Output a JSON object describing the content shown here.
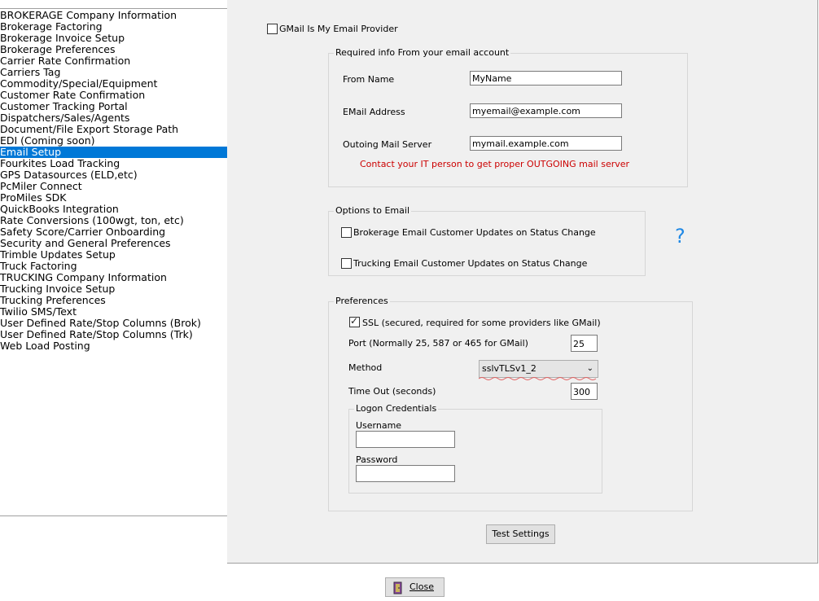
{
  "sidebar": {
    "items": [
      "BROKERAGE Company Information",
      "Brokerage Factoring",
      "Brokerage Invoice Setup",
      "Brokerage Preferences",
      "Carrier Rate Confirmation",
      "Carriers Tag",
      "Commodity/Special/Equipment",
      "Customer Rate Confirmation",
      "Customer Tracking Portal",
      "Dispatchers/Sales/Agents",
      "Document/File Export Storage Path",
      "EDI (Coming soon)",
      "Email Setup",
      "Fourkites Load Tracking",
      "GPS Datasources (ELD,etc)",
      "PcMiler Connect",
      "ProMiles SDK",
      "QuickBooks Integration",
      "Rate Conversions (100wgt, ton, etc)",
      "Safety Score/Carrier Onboarding",
      "Security and General Preferences",
      "Trimble Updates Setup",
      "Truck Factoring",
      "TRUCKING Company Information",
      "Trucking Invoice Setup",
      "Trucking Preferences",
      "Twilio SMS/Text",
      "User Defined Rate/Stop Columns (Brok)",
      "User Defined Rate/Stop Columns (Trk)",
      "Web Load Posting"
    ],
    "selected": "Email Setup"
  },
  "gmail": {
    "label": "GMail Is My Email Provider",
    "checked": false
  },
  "required": {
    "title": "Required info From your email account",
    "from_name_label": "From Name",
    "from_name_value": "MyName",
    "email_label": "EMail Address",
    "email_value": "myemail@example.com",
    "server_label": "Outoing Mail Server",
    "server_value": "mymail.example.com",
    "warning": "Contact your IT person to get proper OUTGOING mail server",
    "warning_color": "#cc0000"
  },
  "options": {
    "title": "Options to Email",
    "brokerage_label": "Brokerage Email Customer Updates on Status Change",
    "brokerage_checked": false,
    "trucking_label": "Trucking Email Customer Updates on Status Change",
    "trucking_checked": false,
    "help_glyph": "?"
  },
  "preferences": {
    "title": "Preferences",
    "ssl_label": "SSL (secured, required for some providers like GMail)",
    "ssl_checked": true,
    "port_label": "Port (Normally 25, 587 or 465 for GMail)",
    "port_value": "25",
    "method_label": "Method",
    "method_value": "sslvTLSv1_2",
    "timeout_label": "Time Out (seconds)",
    "timeout_value": "300",
    "logon_title": "Logon Credentials",
    "username_label": "Username",
    "username_value": "",
    "password_label": "Password",
    "password_value": ""
  },
  "buttons": {
    "test_settings": "Test Settings",
    "close": "Close"
  },
  "colors": {
    "selection": "#0078d7",
    "panel": "#f0f0f0",
    "help": "#1e88e5"
  }
}
